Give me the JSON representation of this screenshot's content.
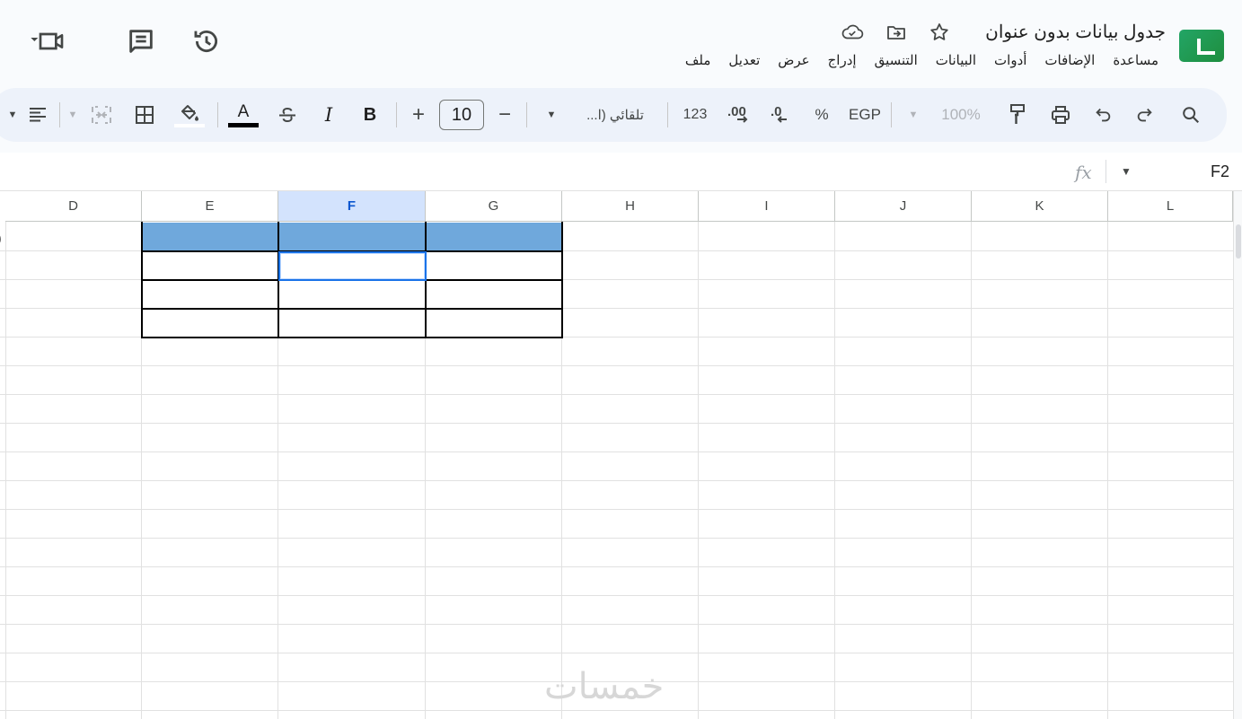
{
  "header": {
    "title": "جدول بيانات بدون عنوان",
    "menu": [
      "ملف",
      "تعديل",
      "عرض",
      "إدراج",
      "التنسيق",
      "البيانات",
      "أدوات",
      "الإضافات",
      "مساعدة"
    ]
  },
  "toolbar": {
    "zoom": "100%",
    "currency": "EGP",
    "percent": "%",
    "dec_decrease": ".0",
    "dec_increase": ".00",
    "number_format": "123",
    "font_name": "تلقائي (ا...",
    "font_size": "10",
    "minus": "−",
    "plus": "+",
    "bold": "B",
    "italic": "I",
    "text_color_letter": "A",
    "text_color": "#000000"
  },
  "formula_bar": {
    "cell_ref": "F2",
    "fx": "fx"
  },
  "grid": {
    "columns": [
      "D",
      "E",
      "F",
      "G",
      "H",
      "I",
      "J",
      "K",
      "L"
    ],
    "selected_column": "F",
    "selected_cell": "F2",
    "header_fill": "#6fa8dc"
  },
  "watermark": "خمسات"
}
